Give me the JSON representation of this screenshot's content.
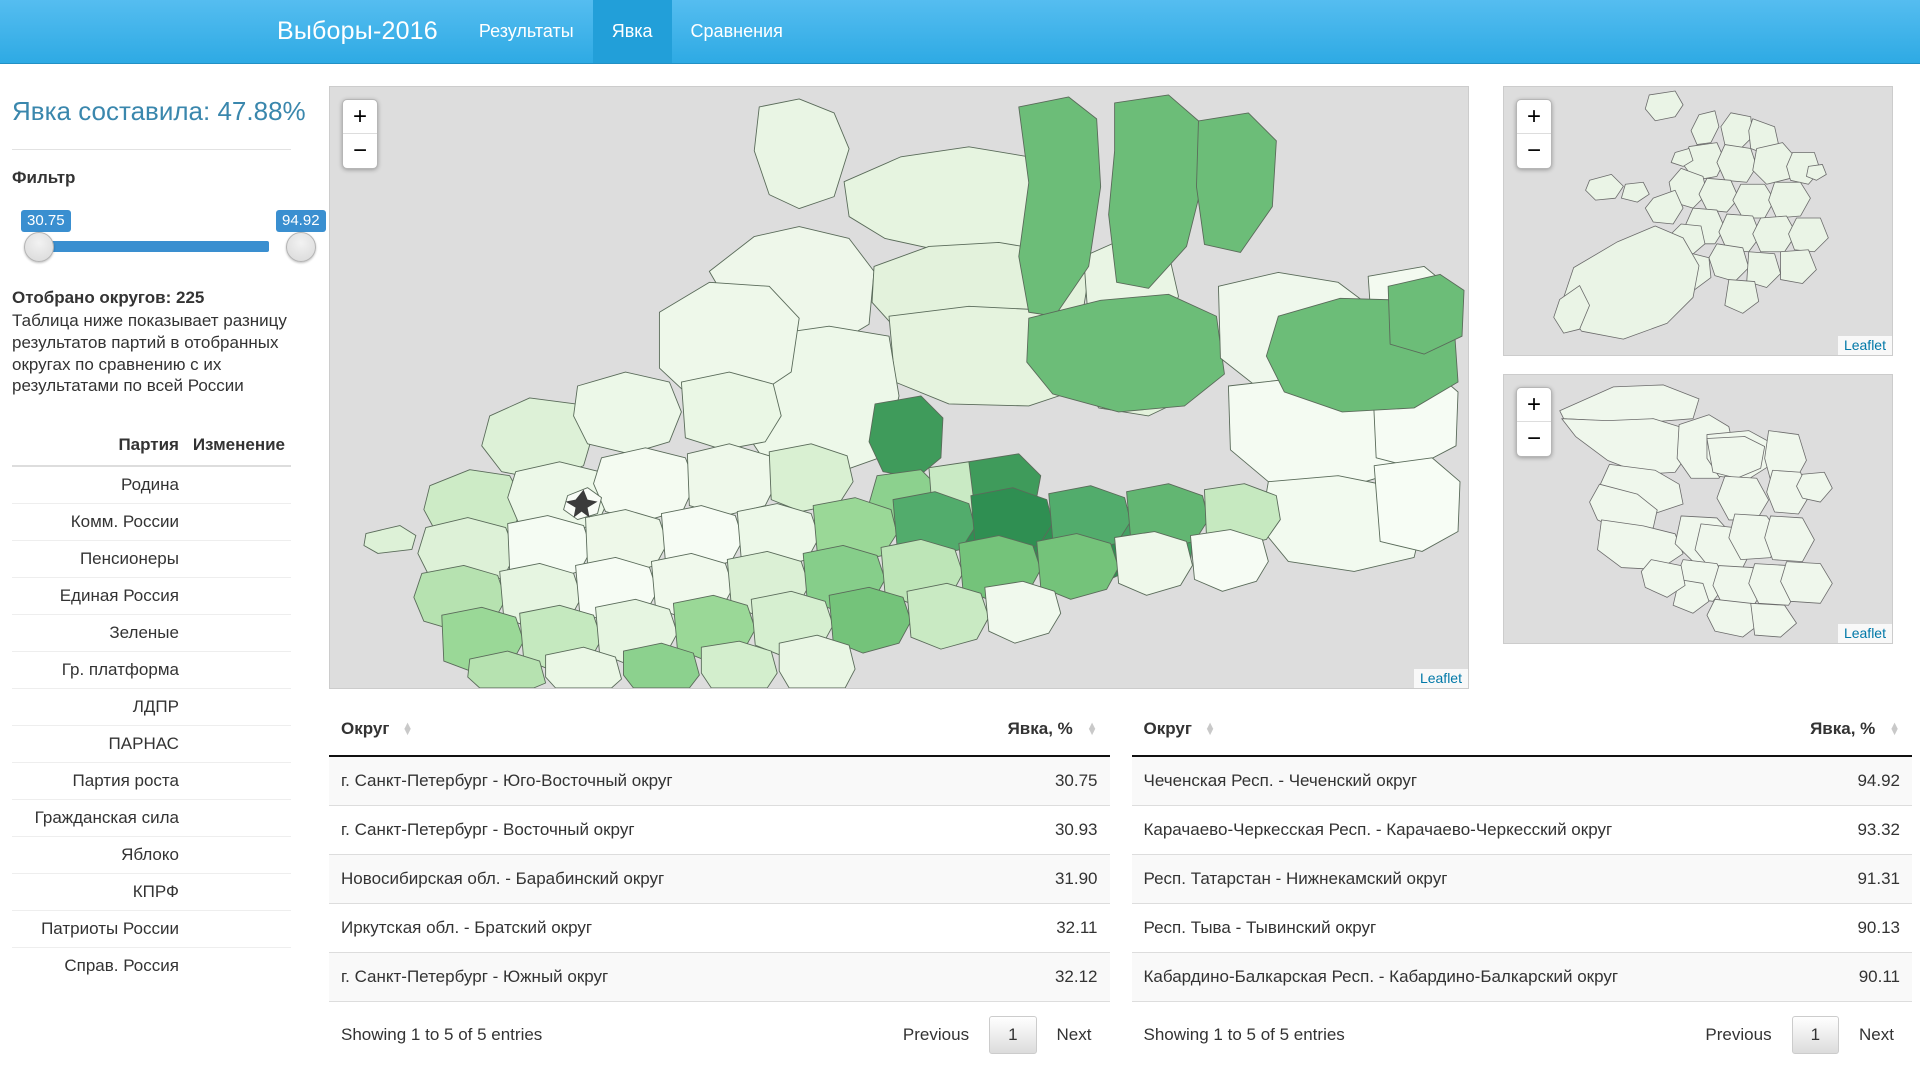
{
  "navbar": {
    "brand": "Выборы-2016",
    "items": [
      {
        "label": "Результаты",
        "active": false
      },
      {
        "label": "Явка",
        "active": true
      },
      {
        "label": "Сравнения",
        "active": false
      }
    ]
  },
  "sidebar": {
    "turnout_headline": "Явка составила: 47.88%",
    "filter_label": "Фильтр",
    "slider": {
      "min_value": "30.75",
      "max_value": "94.92",
      "track_color": "#3a8fd0",
      "tip_color": "#3a8fd0"
    },
    "selected_count": "Отобрано округов: 225",
    "explainer": "Таблица ниже показывает разницу результатов партий в отобранных округах по сравнению с их результатами по всей России",
    "party_table": {
      "headers": [
        "Партия",
        "Изменение"
      ],
      "rows": [
        {
          "party": "Родина",
          "change": ""
        },
        {
          "party": "Комм. России",
          "change": ""
        },
        {
          "party": "Пенсионеры",
          "change": ""
        },
        {
          "party": "Единая Россия",
          "change": ""
        },
        {
          "party": "Зеленые",
          "change": ""
        },
        {
          "party": "Гр. платформа",
          "change": ""
        },
        {
          "party": "ЛДПР",
          "change": ""
        },
        {
          "party": "ПАРНАС",
          "change": ""
        },
        {
          "party": "Партия роста",
          "change": ""
        },
        {
          "party": "Гражданская сила",
          "change": ""
        },
        {
          "party": "Яблоко",
          "change": ""
        },
        {
          "party": "КПРФ",
          "change": ""
        },
        {
          "party": "Патриоты России",
          "change": ""
        },
        {
          "party": "Справ. Россия",
          "change": ""
        }
      ]
    }
  },
  "maps": {
    "zoom_in_label": "+",
    "zoom_out_label": "−",
    "attribution": "Leaflet",
    "background_color": "#dddddd",
    "choropleth_colors": [
      "#f7fcf5",
      "#e8f6e3",
      "#d3eecd",
      "#b7e2b1",
      "#97d494",
      "#73c378",
      "#4daf62"
    ],
    "big_map_name": "Россия",
    "inset_1_name": "Московская агломерация",
    "inset_2_name": "Санкт-Петербург и область"
  },
  "tables": {
    "left": {
      "headers": [
        "Округ",
        "Явка, %"
      ],
      "rows": [
        {
          "district": "г. Санкт-Петербург - Юго-Восточный округ",
          "turnout": "30.75"
        },
        {
          "district": "г. Санкт-Петербург - Восточный округ",
          "turnout": "30.93"
        },
        {
          "district": "Новосибирская обл. - Барабинский округ",
          "turnout": "31.90"
        },
        {
          "district": "Иркутская обл. - Братский округ",
          "turnout": "32.11"
        },
        {
          "district": "г. Санкт-Петербург - Южный округ",
          "turnout": "32.12"
        }
      ],
      "info": "Showing 1 to 5 of 5 entries",
      "pager": {
        "previous": "Previous",
        "page": "1",
        "next": "Next"
      }
    },
    "right": {
      "headers": [
        "Округ",
        "Явка, %"
      ],
      "rows": [
        {
          "district": "Чеченская Респ. - Чеченский округ",
          "turnout": "94.92"
        },
        {
          "district": "Карачаево-Черкесская Респ. - Карачаево-Черкесский округ",
          "turnout": "93.32"
        },
        {
          "district": "Респ. Татарстан - Нижнекамский округ",
          "turnout": "91.31"
        },
        {
          "district": "Респ. Тыва - Тывинский округ",
          "turnout": "90.13"
        },
        {
          "district": "Кабардино-Балкарская Респ. - Кабардино-Балкарский округ",
          "turnout": "90.11"
        }
      ],
      "info": "Showing 1 to 5 of 5 entries",
      "pager": {
        "previous": "Previous",
        "page": "1",
        "next": "Next"
      }
    }
  }
}
